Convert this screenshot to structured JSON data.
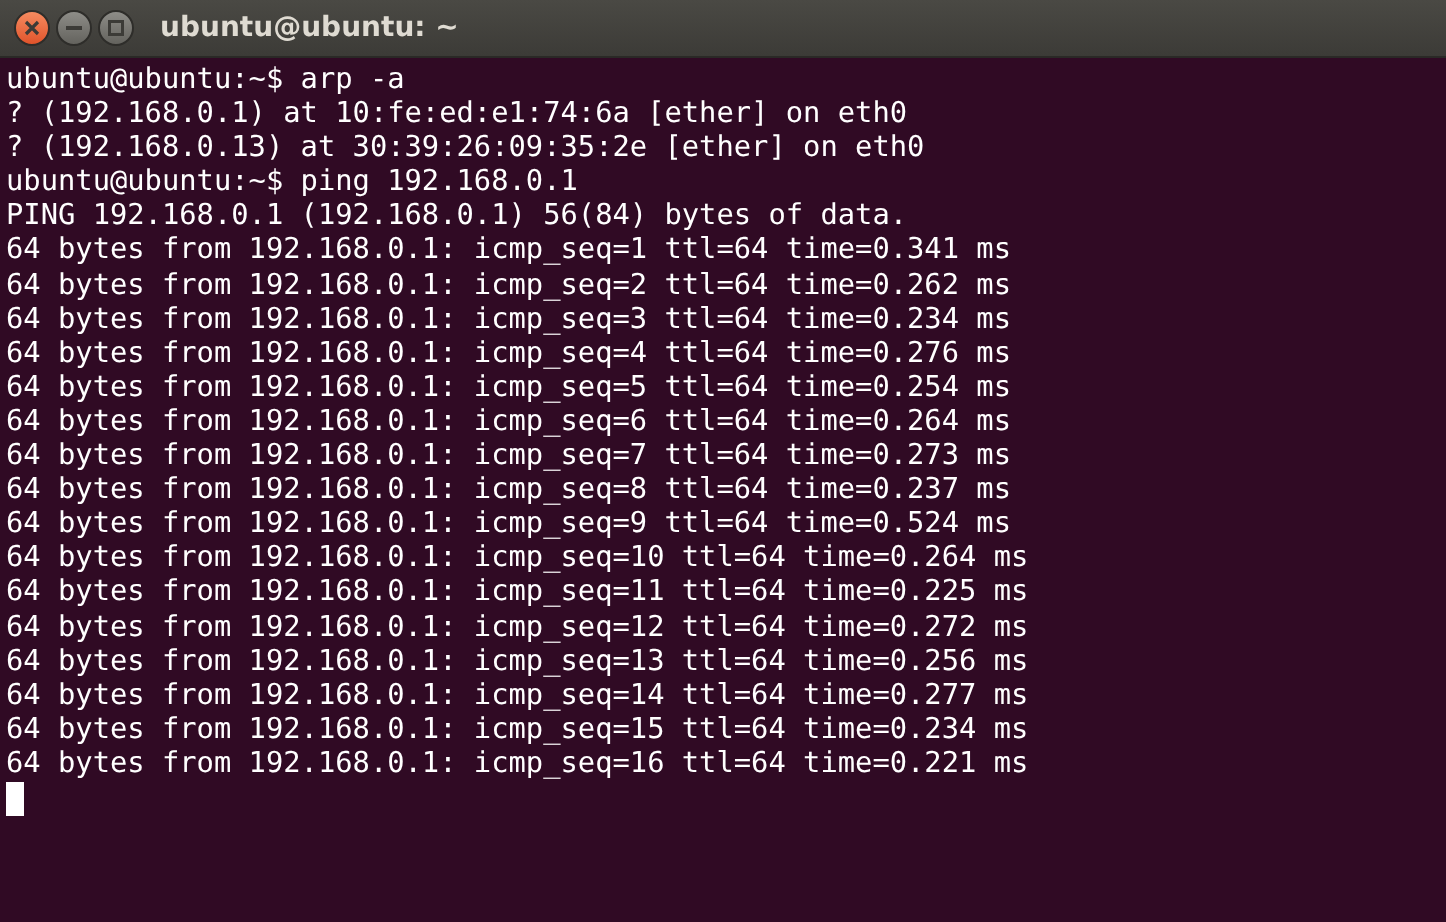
{
  "window": {
    "title": "ubuntu@ubuntu: ~"
  },
  "terminal": {
    "lines": [
      "ubuntu@ubuntu:~$ arp -a",
      "? (192.168.0.1) at 10:fe:ed:e1:74:6a [ether] on eth0",
      "? (192.168.0.13) at 30:39:26:09:35:2e [ether] on eth0",
      "ubuntu@ubuntu:~$ ping 192.168.0.1",
      "PING 192.168.0.1 (192.168.0.1) 56(84) bytes of data.",
      "64 bytes from 192.168.0.1: icmp_seq=1 ttl=64 time=0.341 ms",
      "64 bytes from 192.168.0.1: icmp_seq=2 ttl=64 time=0.262 ms",
      "64 bytes from 192.168.0.1: icmp_seq=3 ttl=64 time=0.234 ms",
      "64 bytes from 192.168.0.1: icmp_seq=4 ttl=64 time=0.276 ms",
      "64 bytes from 192.168.0.1: icmp_seq=5 ttl=64 time=0.254 ms",
      "64 bytes from 192.168.0.1: icmp_seq=6 ttl=64 time=0.264 ms",
      "64 bytes from 192.168.0.1: icmp_seq=7 ttl=64 time=0.273 ms",
      "64 bytes from 192.168.0.1: icmp_seq=8 ttl=64 time=0.237 ms",
      "64 bytes from 192.168.0.1: icmp_seq=9 ttl=64 time=0.524 ms",
      "64 bytes from 192.168.0.1: icmp_seq=10 ttl=64 time=0.264 ms",
      "64 bytes from 192.168.0.1: icmp_seq=11 ttl=64 time=0.225 ms",
      "64 bytes from 192.168.0.1: icmp_seq=12 ttl=64 time=0.272 ms",
      "64 bytes from 192.168.0.1: icmp_seq=13 ttl=64 time=0.256 ms",
      "64 bytes from 192.168.0.1: icmp_seq=14 ttl=64 time=0.277 ms",
      "64 bytes from 192.168.0.1: icmp_seq=15 ttl=64 time=0.234 ms",
      "64 bytes from 192.168.0.1: icmp_seq=16 ttl=64 time=0.221 ms"
    ]
  }
}
